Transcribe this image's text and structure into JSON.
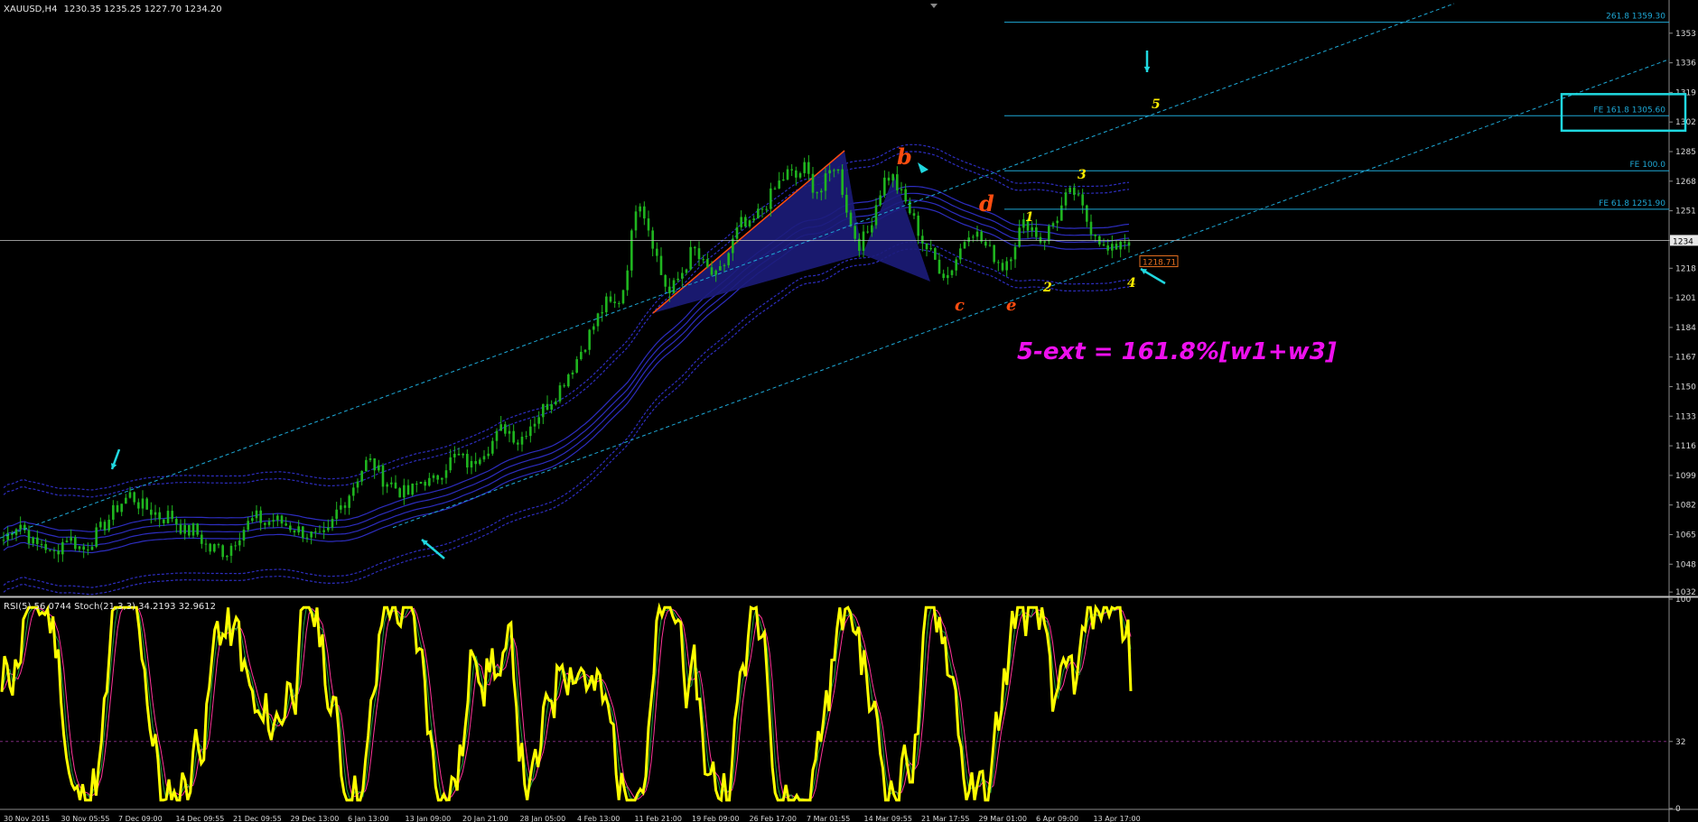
{
  "window": {
    "title": "XAUUSD,H4",
    "ohlc": "1230.35 1235.25 1227.70 1234.20",
    "indicator_label": "RSI(5) 56.0744  Stoch(21,3,3) 34.2193 32.9612"
  },
  "colors": {
    "background": "#000000",
    "candles": "#1fb51f",
    "levels": "#1ea8d6",
    "wave_orange": "#ff4d10",
    "wave_yellow": "#ffee00",
    "annotation_magenta": "#ee10ee",
    "pattern_fill": "#1c1c7a",
    "envelope": "#2d2dbf",
    "oscillator": "#ffff00",
    "signal": "#ff3399",
    "highlight_box": "#20d8e0"
  },
  "chart_data": [
    {
      "type": "candlestick",
      "symbol": "XAUUSD",
      "timeframe": "H4",
      "ylim": [
        1030,
        1370
      ],
      "y_ticks": [
        1032,
        1048,
        1065,
        1082,
        1099,
        1116,
        1133,
        1150,
        1167,
        1184,
        1201,
        1218,
        1234,
        1251,
        1268,
        1285,
        1302,
        1319,
        1336,
        1353
      ],
      "x_ticks": [
        "30 Nov 2015",
        "30 Nov 05:55",
        "7 Dec 09:00",
        "14 Dec 09:55",
        "21 Dec 09:55",
        "29 Dec 13:00",
        "6 Jan 13:00",
        "13 Jan 09:00",
        "20 Jan 21:00",
        "28 Jan 05:00",
        "4 Feb 13:00",
        "11 Feb 21:00",
        "19 Feb 09:00",
        "26 Feb 17:00",
        "7 Mar 01:55",
        "14 Mar 09:55",
        "21 Mar 17:55",
        "29 Mar 01:00",
        "6 Apr 09:00",
        "13 Apr 17:00"
      ],
      "price_path": [
        1062,
        1068,
        1072,
        1065,
        1058,
        1061,
        1052,
        1058,
        1064,
        1060,
        1056,
        1061,
        1067,
        1072,
        1079,
        1084,
        1088,
        1083,
        1080,
        1078,
        1074,
        1077,
        1071,
        1066,
        1068,
        1062,
        1056,
        1058,
        1054,
        1061,
        1067,
        1072,
        1075,
        1071,
        1074,
        1072,
        1070,
        1068,
        1066,
        1064,
        1062,
        1066,
        1078,
        1084,
        1092,
        1101,
        1108,
        1103,
        1096,
        1094,
        1090,
        1088,
        1093,
        1097,
        1094,
        1100,
        1106,
        1110,
        1108,
        1104,
        1112,
        1115,
        1120,
        1127,
        1124,
        1118,
        1126,
        1131,
        1137,
        1142,
        1148,
        1156,
        1163,
        1172,
        1181,
        1190,
        1198,
        1196,
        1202,
        1228,
        1262,
        1247,
        1232,
        1214,
        1203,
        1211,
        1219,
        1230,
        1221,
        1216,
        1212,
        1221,
        1233,
        1244,
        1240,
        1248,
        1254,
        1261,
        1268,
        1273,
        1270,
        1276,
        1266,
        1261,
        1271,
        1279,
        1260,
        1240,
        1232,
        1238,
        1254,
        1268,
        1272,
        1262,
        1254,
        1244,
        1233,
        1226,
        1219,
        1213,
        1222,
        1232,
        1242,
        1236,
        1230,
        1225,
        1219,
        1226,
        1238,
        1245,
        1240,
        1233,
        1241,
        1248,
        1258,
        1262,
        1253,
        1242,
        1238,
        1227,
        1228,
        1235,
        1234
      ],
      "levels": [
        {
          "label": "261.8  1359.30",
          "price": 1359.3
        },
        {
          "label": "FE 161.8  1305.60",
          "price": 1305.6
        },
        {
          "label": "FE 100.0",
          "price": 1274.0
        },
        {
          "label": "FE 61.8  1251.90",
          "price": 1251.9
        }
      ],
      "current_price": "1234",
      "marked_price": "1218.71",
      "waves_orange": [
        {
          "label": "b",
          "x": "7 Mar 01:55",
          "price": 1282
        },
        {
          "label": "c",
          "x": "21 Mar 17:55",
          "price": 1199
        },
        {
          "label": "d",
          "x": "29 Mar 01:00",
          "price": 1257
        },
        {
          "label": "e",
          "x": "29 Mar 01:00",
          "price": 1199
        }
      ],
      "waves_yellow": [
        {
          "label": "1",
          "price": 1248
        },
        {
          "label": "2",
          "price": 1212
        },
        {
          "label": "3",
          "price": 1268
        },
        {
          "label": "4",
          "price": 1211
        },
        {
          "label": "5",
          "price": 1303
        }
      ],
      "annotation": "5-ext = 161.8%[w1+w3]"
    },
    {
      "type": "line",
      "name": "RSI(5) / Stoch(21,3,3)",
      "ylim": [
        0,
        100
      ],
      "y_ticks": [
        0,
        32,
        100
      ],
      "level": 32,
      "rsi_last": 56.0744,
      "stoch_main": 34.2193,
      "stoch_signal": 32.9612
    }
  ]
}
